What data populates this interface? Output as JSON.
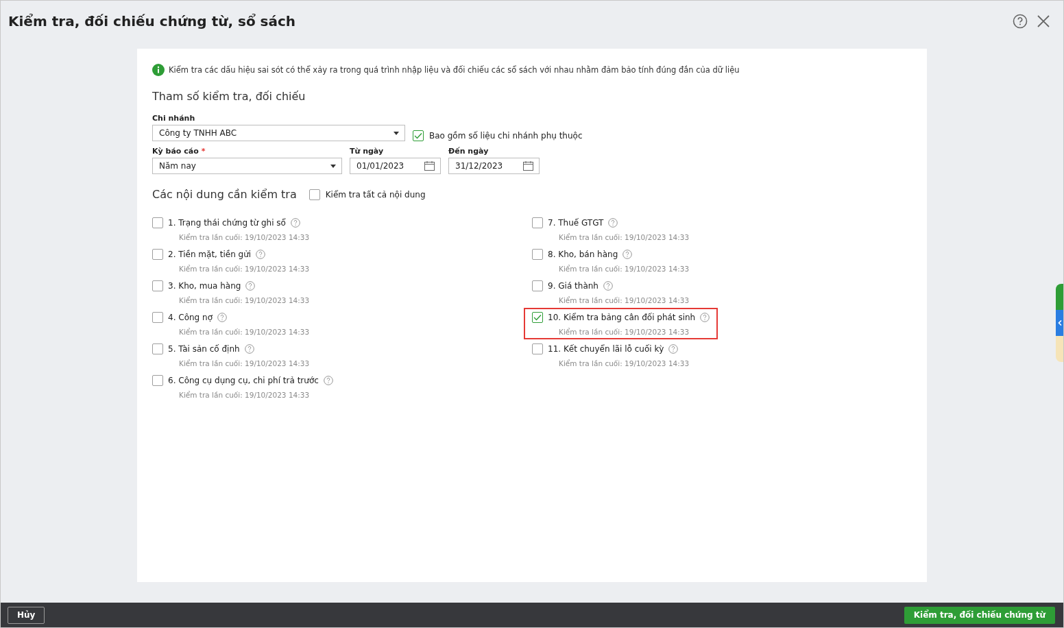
{
  "window": {
    "title": "Kiểm tra, đối chiếu chứng từ, sổ sách"
  },
  "info": "Kiểm tra các dấu hiệu sai sót có thể xảy ra trong quá trình nhập liệu và đối chiếu các sổ sách với nhau nhằm đảm bảo tính đúng đắn của dữ liệu",
  "params_heading": "Tham số kiểm tra, đối chiếu",
  "branch": {
    "label": "Chi nhánh",
    "value": "Công ty TNHH ABC"
  },
  "include_dependent": {
    "label": "Bao gồm số liệu chi nhánh phụ thuộc",
    "checked": true
  },
  "period": {
    "label": "Kỳ báo cáo",
    "required_mark": "*",
    "value": "Năm nay"
  },
  "from_date": {
    "label": "Từ ngày",
    "value": "01/01/2023"
  },
  "to_date": {
    "label": "Đến ngày",
    "value": "31/12/2023"
  },
  "contents_heading": "Các nội dung cần kiểm tra",
  "check_all": {
    "label": "Kiểm tra tất cả nội dung",
    "checked": false
  },
  "columns": [
    [
      {
        "label": "1. Trạng thái chứng từ ghi sổ",
        "last_check": "Kiểm tra lần cuối: 19/10/2023 14:33",
        "checked": false,
        "highlighted": false
      },
      {
        "label": "2. Tiền mặt, tiền gửi",
        "last_check": "Kiểm tra lần cuối: 19/10/2023 14:33",
        "checked": false,
        "highlighted": false
      },
      {
        "label": "3. Kho, mua hàng",
        "last_check": "Kiểm tra lần cuối: 19/10/2023 14:33",
        "checked": false,
        "highlighted": false
      },
      {
        "label": "4. Công nợ",
        "last_check": "Kiểm tra lần cuối: 19/10/2023 14:33",
        "checked": false,
        "highlighted": false
      },
      {
        "label": "5. Tài sản cố định",
        "last_check": "Kiểm tra lần cuối: 19/10/2023 14:33",
        "checked": false,
        "highlighted": false
      },
      {
        "label": "6. Công cụ dụng cụ, chi phí trả trước",
        "last_check": "Kiểm tra lần cuối: 19/10/2023 14:33",
        "checked": false,
        "highlighted": false
      }
    ],
    [
      {
        "label": "7. Thuế GTGT",
        "last_check": "Kiểm tra lần cuối: 19/10/2023 14:33",
        "checked": false,
        "highlighted": false
      },
      {
        "label": "8. Kho, bán hàng",
        "last_check": "Kiểm tra lần cuối: 19/10/2023 14:33",
        "checked": false,
        "highlighted": false
      },
      {
        "label": "9. Giá thành",
        "last_check": "Kiểm tra lần cuối: 19/10/2023 14:33",
        "checked": false,
        "highlighted": false
      },
      {
        "label": "10. Kiểm tra bảng cân đối phát sinh",
        "last_check": "Kiểm tra lần cuối: 19/10/2023 14:33",
        "checked": true,
        "highlighted": true
      },
      {
        "label": "11. Kết chuyển lãi lỗ cuối kỳ",
        "last_check": "Kiểm tra lần cuối: 19/10/2023 14:33",
        "checked": false,
        "highlighted": false
      }
    ]
  ],
  "footer": {
    "cancel": "Hủy",
    "submit": "Kiểm tra, đối chiếu chứng từ"
  }
}
